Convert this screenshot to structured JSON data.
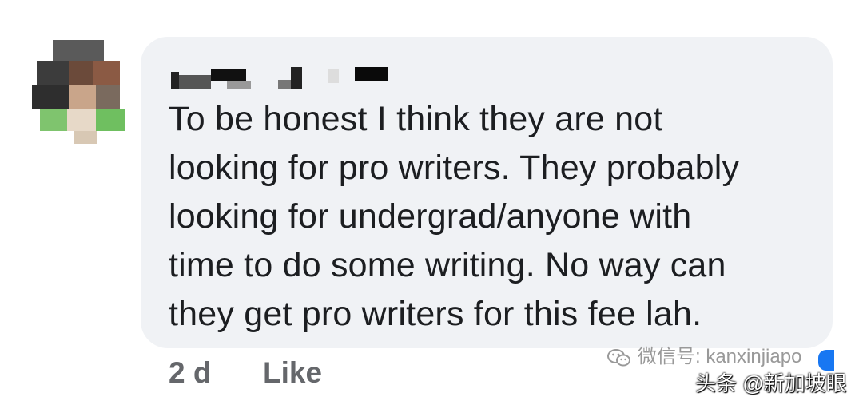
{
  "comment": {
    "author": "",
    "text": "To be honest I think they are not\nlooking for pro writers. They probably\nlooking for undergrad/anyone with\ntime to do some writing. No way can\nthey get pro writers for this fee lah.",
    "time": "2 d",
    "like_label": "Like"
  },
  "colors": {
    "bubble": "#f0f2f5",
    "text": "#1c1e21",
    "meta": "#65676b",
    "accent": "#1877f2"
  },
  "watermark": {
    "wechat_icon": "wechat-icon",
    "wechat_text": "微信号: kanxinjiapo",
    "toutiao_text": "头条 @新加坡眼"
  }
}
